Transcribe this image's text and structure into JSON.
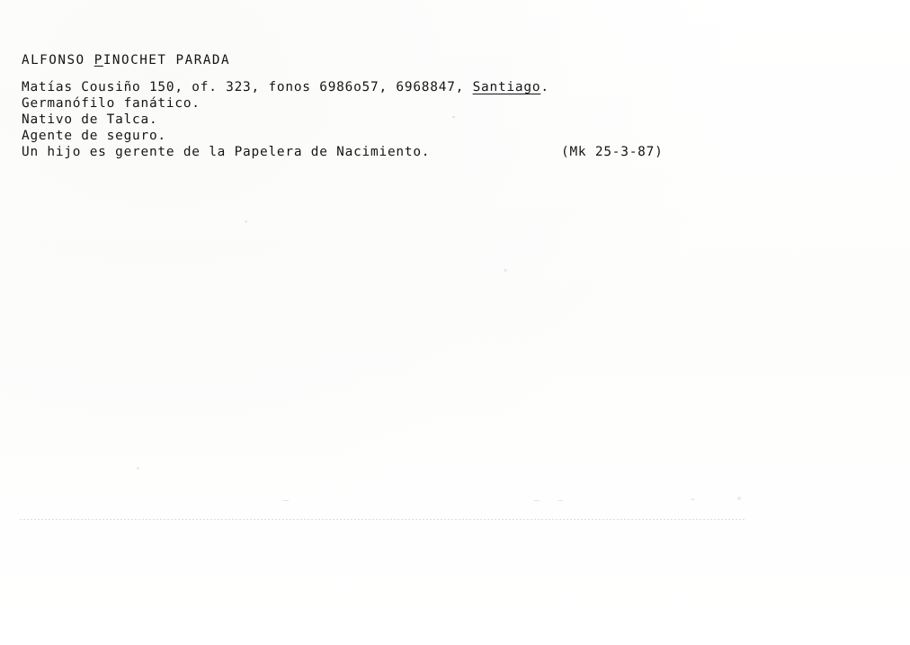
{
  "document": {
    "type": "typewritten-index-card",
    "language": "es",
    "subject": {
      "full_name": "ALFONSO PINOCHET PARADA",
      "name_prefix": "ALFONSO ",
      "underlined_initial": "P",
      "name_suffix": "INOCHET PARADA"
    },
    "lines": [
      {
        "id": "address-line",
        "prefix": "Matías Cousiño 150, of. 323, fonos 6986o57, 6968847, ",
        "underlined": "Santiago",
        "suffix": "."
      },
      {
        "id": "trait-line",
        "text": "Germanófilo fanático."
      },
      {
        "id": "origin-line",
        "text": "Nativo de Talca."
      },
      {
        "id": "occupation-line",
        "text": "Agente de seguro."
      },
      {
        "id": "family-line",
        "text": "Un hijo es gerente de la Papelera de Nacimiento."
      }
    ],
    "reference_code": "(Mk 25-3-87)"
  },
  "colors": {
    "paper": "#fefefe",
    "ink": "#141414",
    "artifact": "#a8a8ac"
  }
}
